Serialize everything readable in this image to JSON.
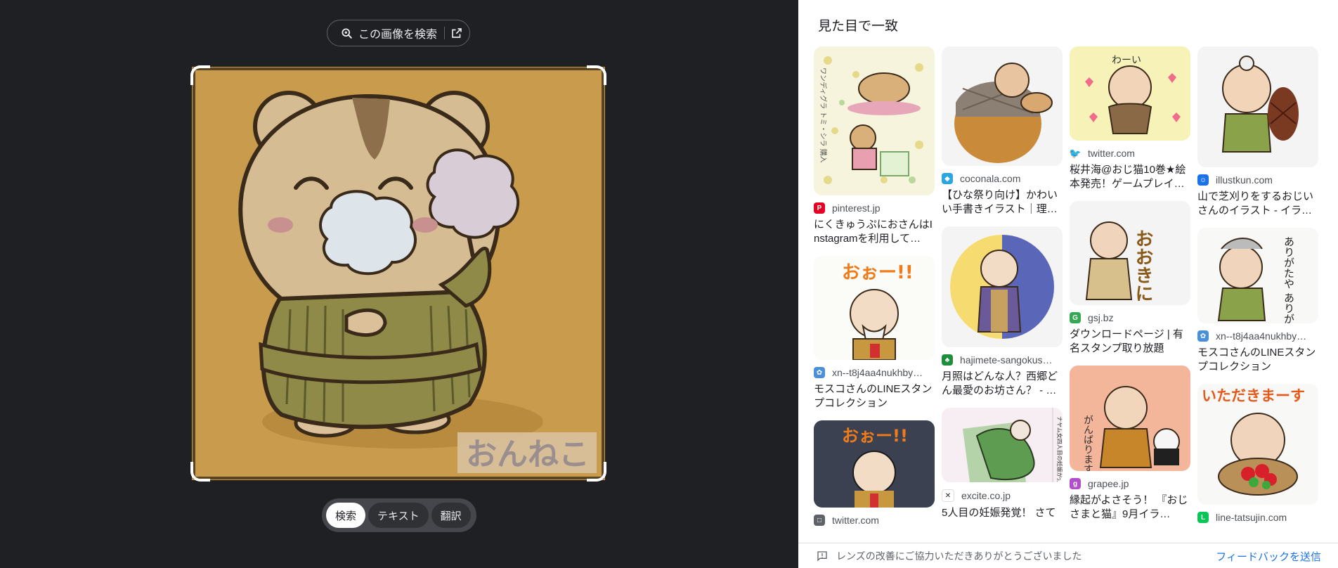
{
  "left_panel": {
    "search_button": "この画像を検索",
    "watermark": "おんねこ",
    "modes": [
      {
        "label": "検索",
        "active": true
      },
      {
        "label": "テキスト",
        "active": false
      },
      {
        "label": "翻訳",
        "active": false
      }
    ]
  },
  "right_panel": {
    "title": "見た目で一致",
    "columns": [
      [
        {
          "source": "pinterest.jp",
          "title": "にくきゅうぷにおさんはInstagramを利用して…",
          "favicon_color": "#e60023",
          "thumb_caption": "ワンディグラ トミ・シラ 購入"
        },
        {
          "source": "xn--t8j4aa4nukhby…",
          "title": "モスコさんのLINEスタンプコレクション",
          "favicon_color": "#4a90d9",
          "thumb_caption": "おぉー!!"
        },
        {
          "source": "twitter.com",
          "title": "",
          "favicon_color": "#5f6368",
          "thumb_caption": "おぉー!!"
        }
      ],
      [
        {
          "source": "coconala.com",
          "title": "【ひな祭り向け】かわいい手書きイラスト｜理…",
          "favicon_color": "#2aa6e0",
          "thumb_caption": ""
        },
        {
          "source": "hajimete-sangokus…",
          "title": "月照はどんな人？西郷どん最愛のお坊さん？ - …",
          "favicon_color": "#1e8e3e",
          "thumb_caption": ""
        },
        {
          "source": "excite.co.jp",
          "title": "5人目の妊娠発覚！ さて",
          "favicon_color": "#202124",
          "thumb_caption": "ナヤム女四人目の妊娠が分かる"
        }
      ],
      [
        {
          "source": "twitter.com",
          "title": "桜井海@おじ猫10巻★絵本発売！ゲームプレイ…",
          "favicon_color": "#1d9bf0",
          "thumb_caption": "わーい"
        },
        {
          "source": "gsj.bz",
          "title": "ダウンロードページ | 有名スタンプ取り放題",
          "favicon_color": "#34a853",
          "thumb_caption": "おおきに"
        },
        {
          "source": "grapee.jp",
          "title": "縁起がよさそう！ 『おじさまと猫』9月イラ…",
          "favicon_color": "#b04fc8",
          "thumb_caption": "がんばります"
        }
      ],
      [
        {
          "source": "illustkun.com",
          "title": "山で芝刈りをするおじいさんのイラスト - イラ…",
          "favicon_color": "#1a73e8",
          "thumb_caption": ""
        },
        {
          "source": "xn--t8j4aa4nukhby…",
          "title": "モスコさんのLINEスタンプコレクション",
          "favicon_color": "#4a90d9",
          "thumb_caption": "ありがたや ありがたや"
        },
        {
          "source": "line-tatsujin.com",
          "title": "",
          "favicon_color": "#06c755",
          "thumb_caption": "いただきまーす"
        }
      ]
    ],
    "footer": {
      "message": "レンズの改善にご協力いただきありがとうございました",
      "feedback_link": "フィードバックを送信"
    }
  },
  "colors": {
    "left_bg": "#1f2023",
    "image_bg": "#c99c4d",
    "link_blue": "#1a73e8"
  }
}
